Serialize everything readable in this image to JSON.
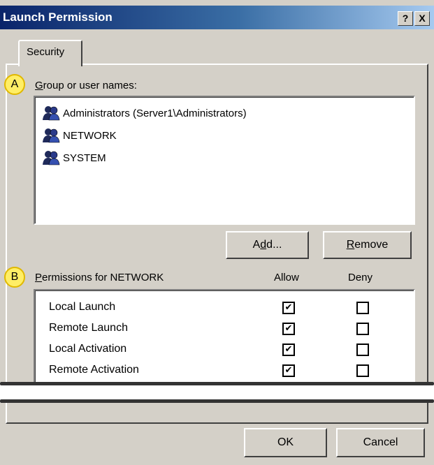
{
  "window": {
    "title": "Launch Permission",
    "help_button": "?",
    "close_button": "X"
  },
  "tabs": [
    {
      "label": "Security"
    }
  ],
  "callouts": {
    "a": "A",
    "b": "B"
  },
  "group_section": {
    "label_accel": "G",
    "label_rest": "roup or user names:",
    "users": [
      {
        "name": "Administrators (Server1\\Administrators)",
        "icon": "user-group-icon"
      },
      {
        "name": "NETWORK",
        "icon": "user-group-icon"
      },
      {
        "name": "SYSTEM",
        "icon": "user-group-icon"
      }
    ],
    "add_button": {
      "pre": "A",
      "accel": "d",
      "post": "d..."
    },
    "remove_button": {
      "accel": "R",
      "post": "emove"
    }
  },
  "permissions_section": {
    "label_accel": "P",
    "label_rest": "ermissions for NETWORK",
    "allow_header": "Allow",
    "deny_header": "Deny",
    "rows": [
      {
        "name": "Local Launch",
        "allow": true,
        "deny": false
      },
      {
        "name": "Remote Launch",
        "allow": true,
        "deny": false
      },
      {
        "name": "Local Activation",
        "allow": true,
        "deny": false
      },
      {
        "name": "Remote Activation",
        "allow": true,
        "deny": false
      }
    ]
  },
  "footer": {
    "ok_button": "OK",
    "cancel_button": "Cancel"
  },
  "colors": {
    "title_gradient_start": "#0a246a",
    "title_gradient_end": "#a6caf0",
    "dialog_face": "#d4d0c8",
    "callout_fill": "#ffee66"
  }
}
